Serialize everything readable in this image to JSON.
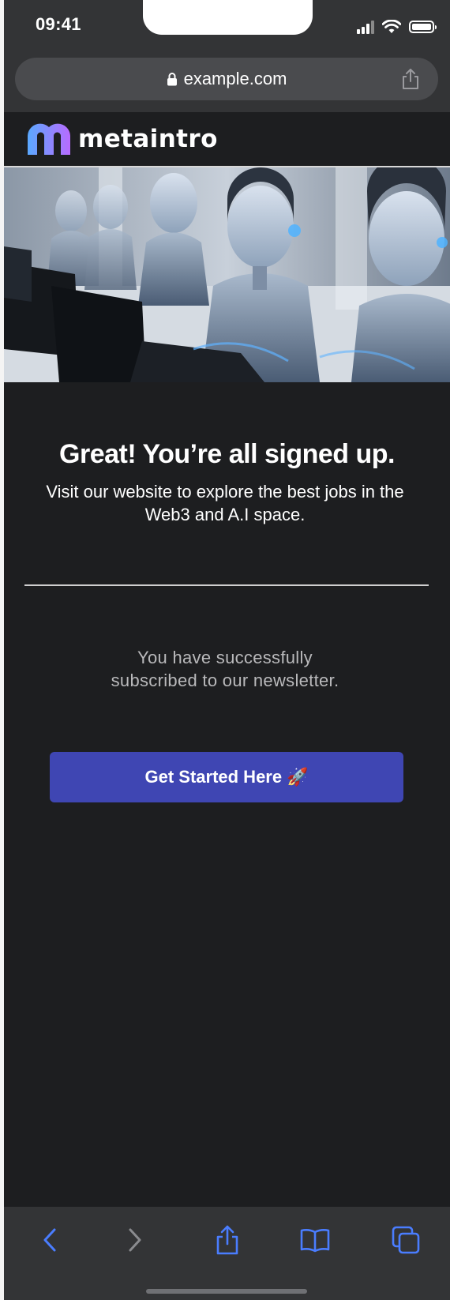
{
  "status_bar": {
    "time": "09:41",
    "icons": [
      "signal-icon",
      "wifi-icon",
      "battery-icon"
    ]
  },
  "browser": {
    "url": "example.com",
    "url_icon": "lock-icon",
    "share_icon": "share-icon"
  },
  "site": {
    "logo_text": "metaintro",
    "hero_alt": "robots working at computers"
  },
  "content": {
    "headline": "Great! You’re all signed up.",
    "subtext": "Visit our website to explore the best jobs in the Web3 and A.I space.",
    "success_line1": "You have successfully",
    "success_line2": "subscribed to our newsletter.",
    "cta_label": "Get Started Here",
    "cta_emoji": "🚀"
  },
  "toolbar": {
    "items": [
      "back-icon",
      "forward-icon",
      "share-icon",
      "bookmarks-icon",
      "tabs-icon"
    ]
  },
  "colors": {
    "page_bg": "#1d1e20",
    "chrome_bg": "#333436",
    "accent_button": "#3f46b3",
    "toolbar_accent": "#4a7dff",
    "logo_gradient": [
      "#5aa9ff",
      "#b86bff"
    ]
  }
}
